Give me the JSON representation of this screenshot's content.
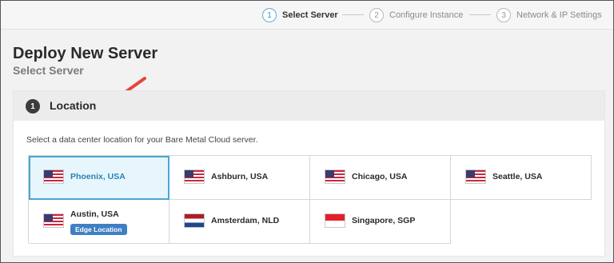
{
  "stepper": {
    "steps": [
      {
        "num": "1",
        "label": "Select Server",
        "active": true
      },
      {
        "num": "2",
        "label": "Configure Instance",
        "active": false
      },
      {
        "num": "3",
        "label": "Network & IP Settings",
        "active": false
      }
    ]
  },
  "page": {
    "title": "Deploy New Server",
    "subtitle": "Select Server"
  },
  "section": {
    "number": "1",
    "title": "Location",
    "description": "Select a data center location for your Bare Metal Cloud server."
  },
  "locations": [
    {
      "city": "Phoenix, USA",
      "flag": "us-flag-icon",
      "selected": true
    },
    {
      "city": "Ashburn, USA",
      "flag": "us-flag-icon",
      "selected": false
    },
    {
      "city": "Chicago, USA",
      "flag": "us-flag-icon",
      "selected": false
    },
    {
      "city": "Seattle, USA",
      "flag": "us-flag-icon",
      "selected": false
    },
    {
      "city": "Austin, USA",
      "flag": "us-flag-icon",
      "selected": false,
      "badge": "Edge Location"
    },
    {
      "city": "Amsterdam, NLD",
      "flag": "nl-flag-icon",
      "selected": false
    },
    {
      "city": "Singapore, SGP",
      "flag": "sg-flag-icon",
      "selected": false
    }
  ],
  "colors": {
    "accent": "#4aa6d1",
    "selected_bg": "#e6f6fc",
    "badge_bg": "#3f7fc4",
    "annotation_arrow": "#e8443a"
  }
}
